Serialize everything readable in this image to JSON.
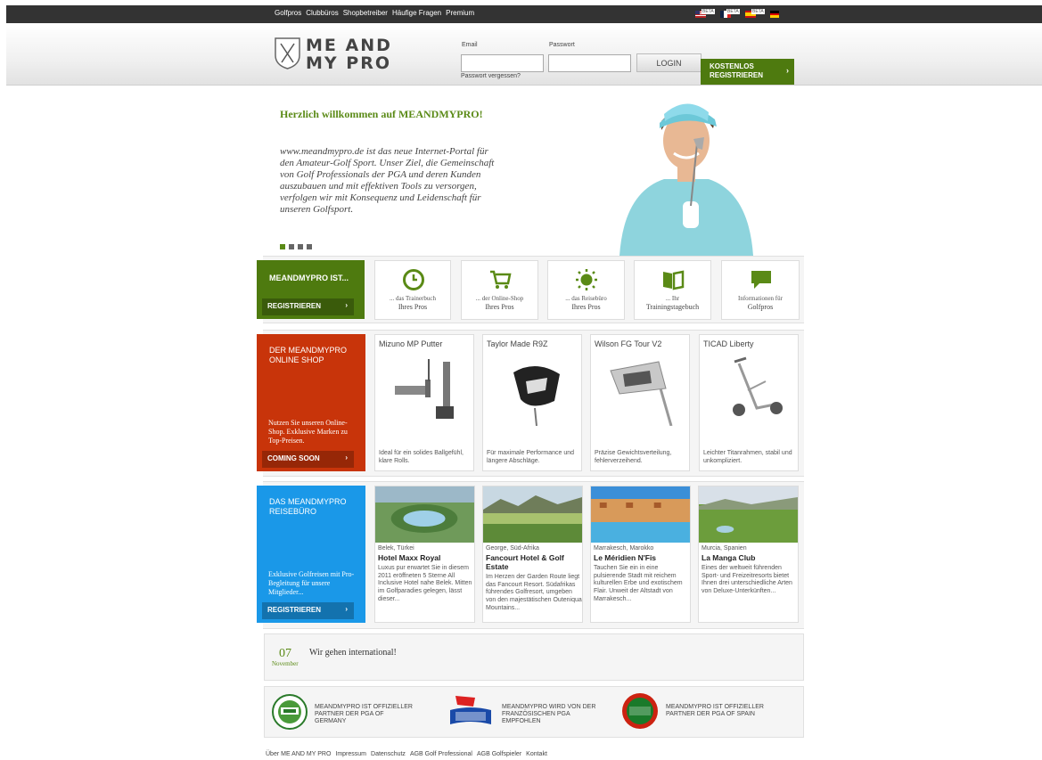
{
  "topnav": [
    "Golfpros",
    "Clubbüros",
    "Shopbetreiber",
    "Häufige Fragen",
    "Premium"
  ],
  "flags": [
    {
      "name": "us-flag-icon",
      "badge": "BETA"
    },
    {
      "name": "fr-flag-icon",
      "badge": "BETA"
    },
    {
      "name": "es-flag-icon",
      "badge": "BETA"
    },
    {
      "name": "de-flag-icon",
      "badge": ""
    }
  ],
  "logo": {
    "line1": "ME AND",
    "line2": "MY PRO"
  },
  "login": {
    "email_label": "Email",
    "email_value": "",
    "password_label": "Passwort",
    "password_value": "",
    "forgot": "Passwort vergessen?",
    "button": "LOGIN",
    "register_line1": "KOSTENLOS",
    "register_line2": "REGISTRIEREN"
  },
  "hero": {
    "title": "Herzlich willkommen auf MEANDMYPRO!",
    "text": "www.meandmypro.de ist das neue Internet-Portal für den Amateur-Golf Sport. Unser Ziel, die Gemeinschaft von Golf Professionals der PGA und deren Kunden auszubauen und mit effektiven Tools zu versorgen, verfolgen wir mit Konsequenz und Leidenschaft für unseren Golfsport."
  },
  "features": {
    "title": "MEANDMYPRO IST...",
    "button": "REGISTRIEREN",
    "items": [
      {
        "icon": "clock-icon",
        "line1": "... das Trainerbuch",
        "line2": "Ihres Pros"
      },
      {
        "icon": "cart-icon",
        "line1": "... der Online-Shop",
        "line2": "Ihres Pros"
      },
      {
        "icon": "sun-icon",
        "line1": "... das Reisebüro",
        "line2": "Ihres Pros"
      },
      {
        "icon": "book-icon",
        "line1": "... Ihr",
        "line2": "Trainingstagebuch"
      },
      {
        "icon": "chat-icon",
        "line1": "Informationen für",
        "line2": "Golfpros"
      }
    ]
  },
  "shop": {
    "title": "DER MEANDMYPRO ONLINE SHOP",
    "desc": "Nutzen Sie unseren Online-Shop. Exklusive Marken zu Top-Preisen.",
    "button": "COMING SOON",
    "products": [
      {
        "name": "Mizuno MP Putter",
        "desc": "Ideal für ein solides Ballgefühl, klare Rolls."
      },
      {
        "name": "Taylor Made R9Z",
        "desc": "Für maximale Performance und längere Abschläge."
      },
      {
        "name": "Wilson FG Tour V2",
        "desc": "Präzise Gewichtsverteilung, fehlerverzeihend."
      },
      {
        "name": "TICAD Liberty",
        "desc": "Leichter Titanrahmen, stabil und unkompliziert."
      }
    ]
  },
  "travel": {
    "title": "DAS MEANDMYPRO REISEBÜRO",
    "desc": "Exklusive Golfreisen mit Pro-Begleitung für unsere Mitglieder...",
    "button": "REGISTRIEREN",
    "items": [
      {
        "loc": "Belek, Türkei",
        "name": "Hotel Maxx Royal",
        "desc": "Luxus pur erwartet Sie in diesem 2011 eröffneten 5 Sterne All Inclusive Hotel nahe Belek. Mitten im Golfparadies gelegen, lässt dieser..."
      },
      {
        "loc": "George, Süd-Afrika",
        "name": "Fancourt Hotel & Golf Estate",
        "desc": "Im Herzen der Garden Route liegt das Fancourt Resort. Südafrikas führendes Golfresort, umgeben von den majestätischen Outeniqua Mountains..."
      },
      {
        "loc": "Marrakesch, Marokko",
        "name": "Le Méridien N'Fis",
        "desc": "Tauchen Sie ein in eine pulsierende Stadt mit reichem kulturellen Erbe und exotischem Flair. Unweit der Altstadt von Marrakesch..."
      },
      {
        "loc": "Murcia, Spanien",
        "name": "La Manga Club",
        "desc": "Eines der weltweit führenden Sport- und Freizeitresorts bietet Ihnen drei unterschiedliche Arten von Deluxe-Unterkünften..."
      }
    ]
  },
  "news": {
    "day": "07",
    "month": "November",
    "text": "Wir gehen international!"
  },
  "partners": [
    {
      "logo": "pga-germany-logo",
      "text": "MEANDMYPRO IST OFFIZIELLER PARTNER DER PGA OF GERMANY"
    },
    {
      "logo": "pga-france-logo",
      "text": "MEANDMYPRO WIRD VON DER FRANZÖSISCHEN PGA EMPFOHLEN"
    },
    {
      "logo": "pga-spain-logo",
      "text": "MEANDMYPRO IST OFFIZIELLER PARTNER DER PGA OF SPAIN"
    }
  ],
  "footer": [
    "Über ME AND MY PRO",
    "Impressum",
    "Datenschutz",
    "AGB Golf Professional",
    "AGB Golfspieler",
    "Kontakt"
  ],
  "colors": {
    "green": "#5a8a16",
    "shop": "#c8340a",
    "travel": "#1a98e8"
  }
}
